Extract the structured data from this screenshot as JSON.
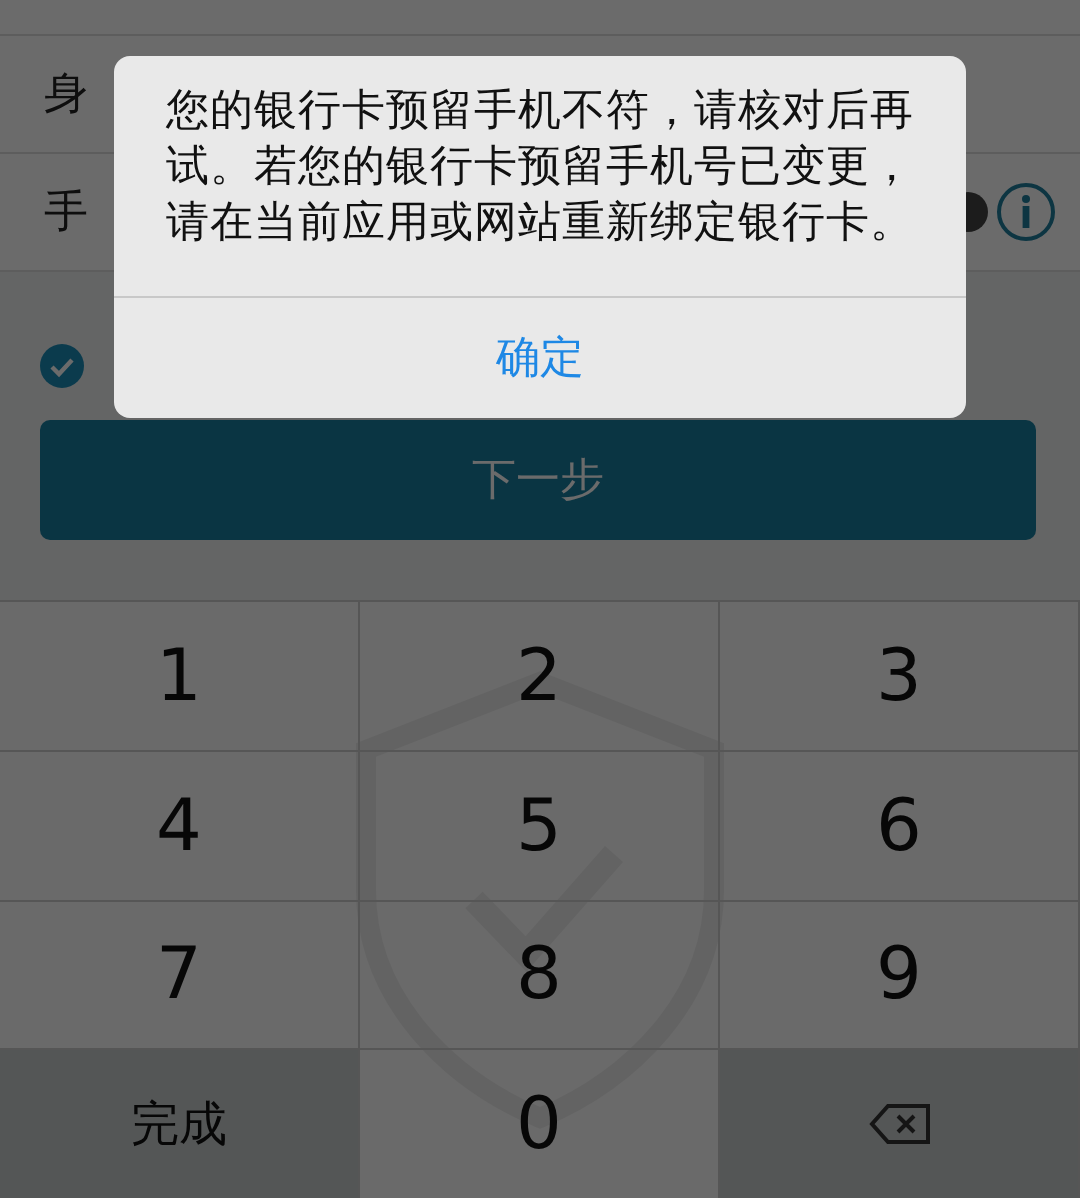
{
  "form": {
    "rows": [
      {
        "label": "身"
      },
      {
        "label": "手"
      }
    ]
  },
  "agreement": {
    "checked": true
  },
  "next_button": "下一步",
  "keypad": {
    "keys": [
      {
        "kind": "digit",
        "label": "1"
      },
      {
        "kind": "digit",
        "label": "2"
      },
      {
        "kind": "digit",
        "label": "3"
      },
      {
        "kind": "digit",
        "label": "4"
      },
      {
        "kind": "digit",
        "label": "5"
      },
      {
        "kind": "digit",
        "label": "6"
      },
      {
        "kind": "digit",
        "label": "7"
      },
      {
        "kind": "digit",
        "label": "8"
      },
      {
        "kind": "digit",
        "label": "9"
      },
      {
        "kind": "action",
        "label": "完成"
      },
      {
        "kind": "zero",
        "label": "0"
      },
      {
        "kind": "backspace"
      }
    ]
  },
  "dialog": {
    "message": "您的银行卡预留手机不符，请核对后再试。若您的银行卡预留手机号已变更，请在当前应用或网站重新绑定银行卡。",
    "button": "确定"
  }
}
